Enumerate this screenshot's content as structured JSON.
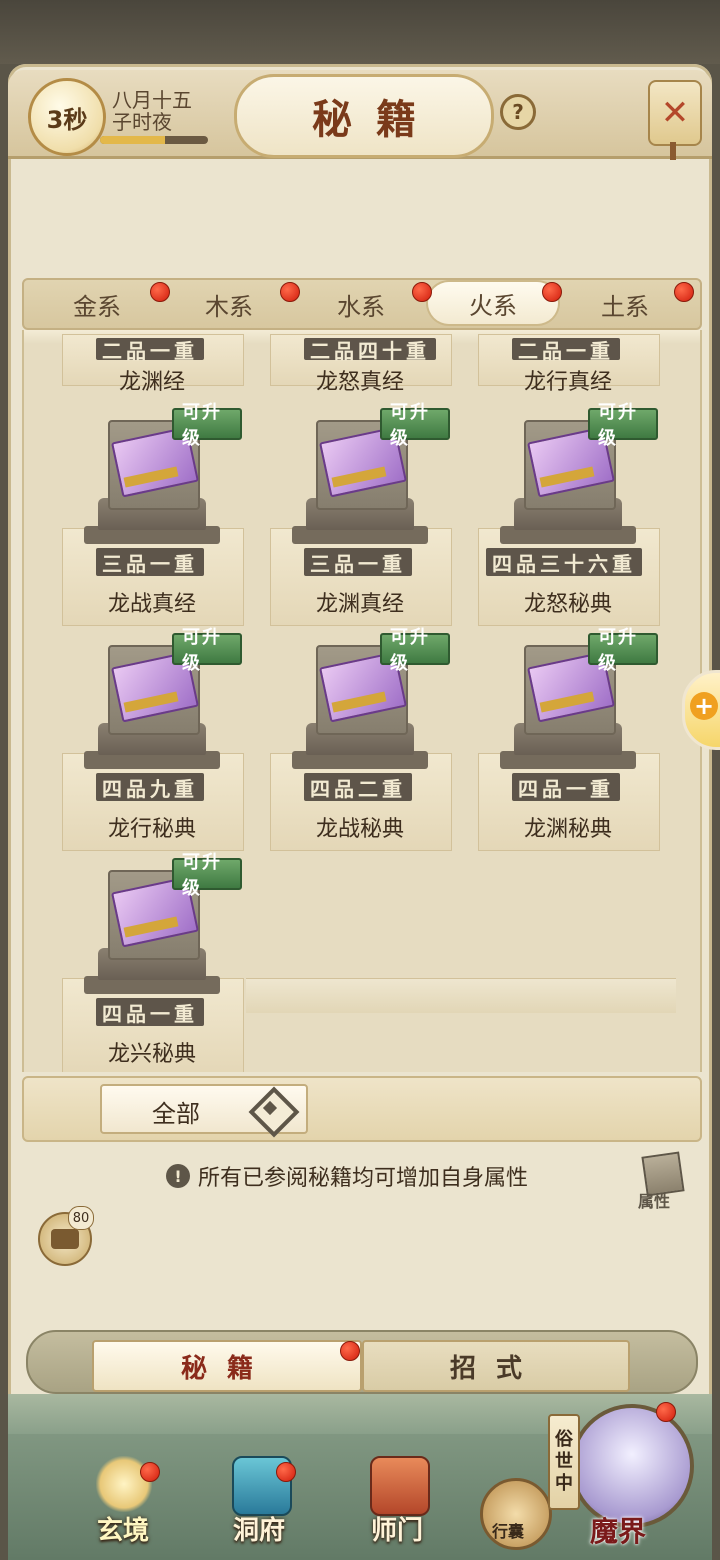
{
  "header": {
    "timer": "3秒",
    "date_line1": "八月十五",
    "date_line2": "子时夜",
    "time_progress": 0.6,
    "title": "秘籍",
    "help_symbol": "?",
    "close_symbol": "✕"
  },
  "element_tabs": [
    {
      "label": "金系",
      "active": false,
      "red_dot": true
    },
    {
      "label": "木系",
      "active": false,
      "red_dot": true
    },
    {
      "label": "水系",
      "active": false,
      "red_dot": true
    },
    {
      "label": "火系",
      "active": true,
      "red_dot": true
    },
    {
      "label": "土系",
      "active": false,
      "red_dot": true
    }
  ],
  "books_partial_row": [
    {
      "grade": "二品一重",
      "name": "龙渊经"
    },
    {
      "grade": "二品四十重",
      "name": "龙怒真经"
    },
    {
      "grade": "二品一重",
      "name": "龙行真经"
    }
  ],
  "books": [
    {
      "badge": "可升级",
      "grade": "三品一重",
      "name": "龙战真经"
    },
    {
      "badge": "可升级",
      "grade": "三品一重",
      "name": "龙渊真经"
    },
    {
      "badge": "可升级",
      "grade": "四品三十六重",
      "name": "龙怒秘典"
    },
    {
      "badge": "可升级",
      "grade": "四品九重",
      "name": "龙行秘典"
    },
    {
      "badge": "可升级",
      "grade": "四品二重",
      "name": "龙战秘典"
    },
    {
      "badge": "可升级",
      "grade": "四品一重",
      "name": "龙渊秘典"
    },
    {
      "badge": "可升级",
      "grade": "四品一重",
      "name": "龙兴秘典"
    }
  ],
  "filter": {
    "selected": "全部"
  },
  "info_text": "所有已参阅秘籍均可增加自身属性",
  "info_icon": "!",
  "attr_button_label": "属性",
  "chat": {
    "count": "80"
  },
  "side_add_symbol": "+",
  "sub_tabs": [
    {
      "label": "秘籍",
      "active": true,
      "red_dot": true
    },
    {
      "label": "招式",
      "active": false,
      "red_dot": false
    }
  ],
  "bottom_nav": [
    {
      "label": "玄境",
      "active": true,
      "red_dot": true
    },
    {
      "label": "洞府",
      "active": false,
      "red_dot": true
    },
    {
      "label": "师门",
      "active": false,
      "red_dot": false
    }
  ],
  "bag_label": "行囊",
  "realm": {
    "tag": "俗世中",
    "label": "魔界",
    "red_dot": true
  }
}
